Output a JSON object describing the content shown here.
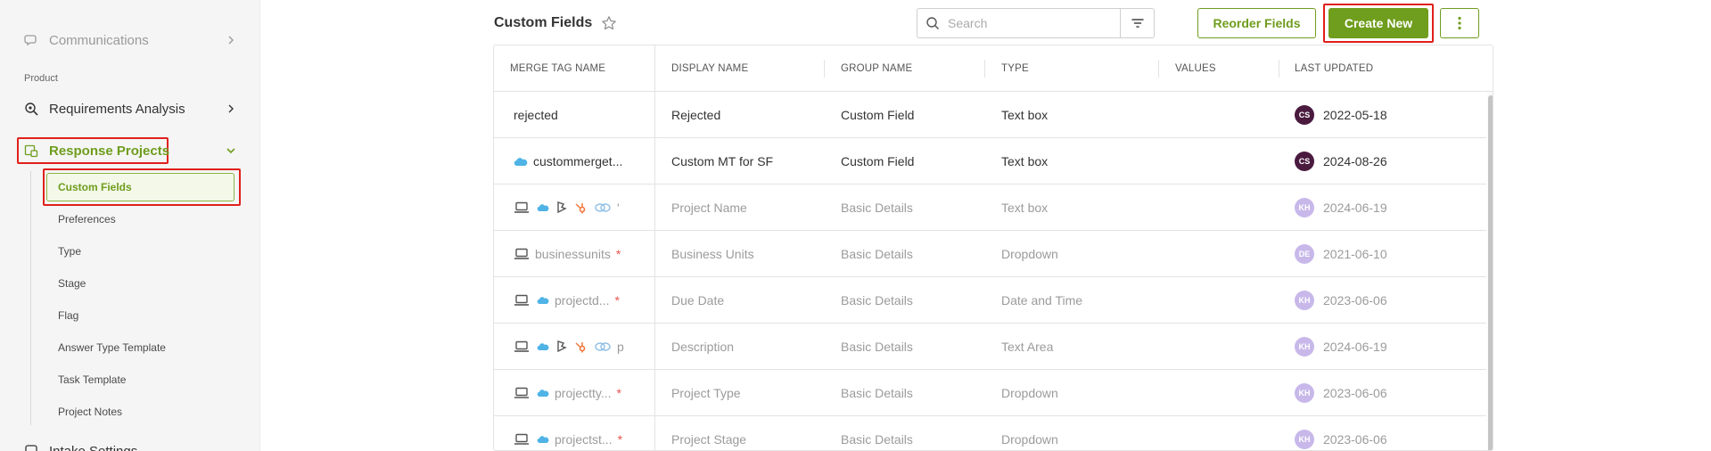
{
  "sidebar": {
    "communications": "Communications",
    "section_product": "Product",
    "requirements_analysis": "Requirements Analysis",
    "response_projects": "Response Projects",
    "sub_items": [
      "Custom Fields",
      "Preferences",
      "Type",
      "Stage",
      "Flag",
      "Answer Type Template",
      "Task Template",
      "Project Notes"
    ],
    "intake_settings": "Intake Settings"
  },
  "header": {
    "title": "Custom Fields",
    "search_placeholder": "Search",
    "reorder_label": "Reorder Fields",
    "create_label": "Create New"
  },
  "table": {
    "columns": [
      "MERGE TAG NAME",
      "DISPLAY NAME",
      "GROUP NAME",
      "TYPE",
      "VALUES",
      "LAST UPDATED"
    ],
    "rows": [
      {
        "merge_tag": "rejected",
        "display": "Rejected",
        "group": "Custom Field",
        "type": "Text box",
        "avatar": "CS",
        "date": "2022-05-18"
      },
      {
        "merge_tag": "custommerget...",
        "display": "Custom MT for SF",
        "group": "Custom Field",
        "type": "Text box",
        "avatar": "CS",
        "date": "2024-08-26"
      },
      {
        "merge_tag": "'",
        "display": "Project Name",
        "group": "Basic Details",
        "type": "Text box",
        "avatar": "KH",
        "date": "2024-06-19"
      },
      {
        "merge_tag": "businessunits",
        "display": "Business Units",
        "group": "Basic Details",
        "type": "Dropdown",
        "avatar": "DE",
        "date": "2021-06-10"
      },
      {
        "merge_tag": "projectd...",
        "display": "Due Date",
        "group": "Basic Details",
        "type": "Date and Time",
        "avatar": "KH",
        "date": "2023-06-06"
      },
      {
        "merge_tag": "p",
        "display": "Description",
        "group": "Basic Details",
        "type": "Text Area",
        "avatar": "KH",
        "date": "2024-06-19"
      },
      {
        "merge_tag": "projectty...",
        "display": "Project Type",
        "group": "Basic Details",
        "type": "Dropdown",
        "avatar": "KH",
        "date": "2023-06-06"
      },
      {
        "merge_tag": "projectst...",
        "display": "Project Stage",
        "group": "Basic Details",
        "type": "Dropdown",
        "avatar": "KH",
        "date": "2023-06-06"
      }
    ],
    "required_marker": "*"
  },
  "colors": {
    "accent": "#6f9d1d",
    "highlight": "#e0201b",
    "salesforce": "#4fb3e6",
    "hubspot": "#f0763c"
  }
}
